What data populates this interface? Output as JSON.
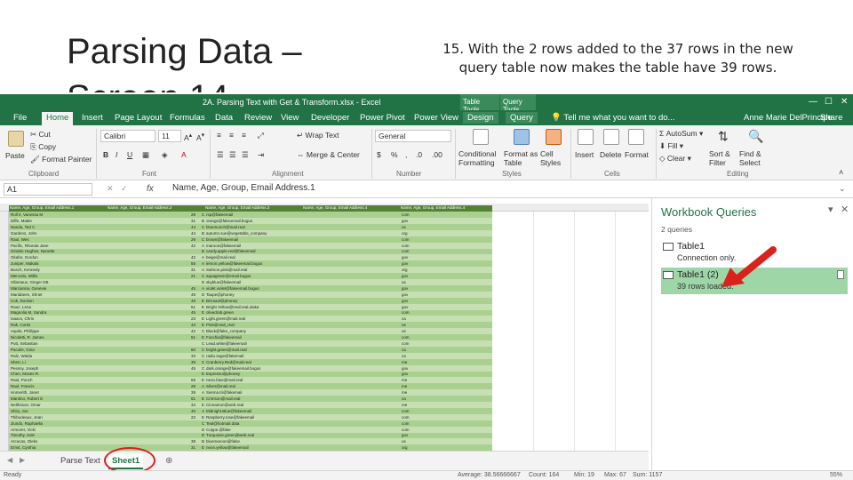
{
  "slide": {
    "title": "Parsing Data – Screen 14",
    "note": "15. With the 2 rows added to the 37 rows in the new query table now makes the table have 39 rows."
  },
  "excel": {
    "window_title": "2A. Parsing Text with Get & Transform.xlsx - Excel",
    "context_tabs": [
      "Table Tools",
      "Query Tools"
    ],
    "ribbon_tabs": [
      "File",
      "Home",
      "Insert",
      "Page Layout",
      "Formulas",
      "Data",
      "Review",
      "View",
      "Developer",
      "Power Pivot",
      "Power View",
      "Design",
      "Query"
    ],
    "active_tab": "Home",
    "tell_me": "Tell me what you want to do...",
    "user": "Anne Marie DelPrincipe",
    "share": "Share",
    "clipboard": {
      "paste": "Paste",
      "cut": "Cut",
      "copy": "Copy",
      "format_painter": "Format Painter",
      "label": "Clipboard"
    },
    "font": {
      "name": "Calibri",
      "size": "11",
      "label": "Font"
    },
    "alignment": {
      "wrap": "Wrap Text",
      "merge": "Merge & Center",
      "label": "Alignment"
    },
    "number": {
      "format": "General",
      "label": "Number"
    },
    "styles": {
      "conditional": "Conditional Formatting",
      "format_table": "Format as Table",
      "cell_styles": "Cell Styles",
      "label": "Styles"
    },
    "cells": {
      "insert": "Insert",
      "delete": "Delete",
      "format": "Format",
      "label": "Cells"
    },
    "editing": {
      "autosum": "AutoSum",
      "fill": "Fill",
      "clear": "Clear",
      "sort": "Sort & Filter",
      "find": "Find & Select",
      "label": "Editing"
    },
    "name_box": "A1",
    "formula": "Name, Age, Group, Email Address.1",
    "table_headers": [
      "Name, Age, Group, Email Address.1",
      "Name, Age, Group, Email Address.2",
      "Name, Age, Group, Email Address.3",
      "Name, Age, Group, Email Address.4"
    ],
    "rows": [
      [
        "Roll II, Vanessa M",
        "29",
        "C",
        "rsp@fakeemail",
        "com"
      ],
      [
        "Diffe, Mattie",
        "31",
        "B",
        "orange@falscemail.bogus",
        "gov"
      ],
      [
        "Nanda, Ted C",
        "44",
        "C",
        "bluemunch@mail.real",
        "us"
      ],
      [
        "Gardens, John",
        "44",
        "B",
        "autumn.sun@vegetable_company",
        "org"
      ],
      [
        "Raul, Wes",
        "29",
        "C",
        "brown@fakeemail",
        "com"
      ],
      [
        "Pacific, Rhonda Jane",
        "42",
        "A",
        "maroon@fakeemail",
        "com"
      ],
      [
        "Giraldo Hughes, Nanette",
        "",
        "B",
        "candy.apple.red@fakeemail",
        "com"
      ],
      [
        "Okafor, Gordon",
        "42",
        "A",
        "beige@mail.real",
        "gov"
      ],
      [
        "Juniper, Makala",
        "55",
        "A",
        "lemon.yellow@fakeemail.bogus",
        "gov"
      ],
      [
        "Bosch, Kennedy",
        "31",
        "A",
        "Salmon.pink@mail.real",
        "org"
      ],
      [
        "Mercutio, Willis",
        "21",
        "C",
        "aquagreen@email.bogus",
        "gov"
      ],
      [
        "Ollantaus, Ginger DB",
        "",
        "D",
        "skyblue@fakeemail",
        "us"
      ],
      [
        "Marcianna, Genevie",
        "45",
        "A",
        "violet.violet@fakeemail.bogus",
        "gov"
      ],
      [
        "Mariabeen, Shriet",
        "49",
        "D",
        "Taupe@phoney",
        "gov"
      ],
      [
        "Cok, Docken",
        "49",
        "E",
        "Bricsaol@phoney",
        "gov"
      ],
      [
        "Rauz, Lena",
        "61",
        "E",
        "Bright.Yellow@mail.real.ulaka",
        "gov"
      ],
      [
        "Magnolia M, Sandra",
        "45",
        "E",
        "olivedrab.green",
        "com"
      ],
      [
        "Isaacs, Chris",
        "23",
        "E",
        "Light.green@mail.real",
        "ca"
      ],
      [
        "Rak, Cortis",
        "43",
        "E",
        "Pink@mail_real",
        "us"
      ],
      [
        "Aquila, Phillippe",
        "42",
        "C",
        "Black@fake_company",
        "us"
      ],
      [
        "Nicoletti, R. James",
        "51",
        "E",
        "Fuschia@fakeemail",
        "com"
      ],
      [
        "Putt, Sebastian",
        "",
        "C",
        "Lead.white@fakeemail",
        "com"
      ],
      [
        "Pacoile, Gina",
        "60",
        "C",
        "bright.green@mail.real",
        "ca"
      ],
      [
        "Ralz, Walda",
        "33",
        "C",
        "radio.sage@fakemail",
        "ca"
      ],
      [
        "Sherr, Li",
        "39",
        "C",
        "Cranberry.Red@mail.real",
        "me"
      ],
      [
        "Pessny, Joseph",
        "45",
        "C",
        "dark.orange@fakeemail.bogus",
        "gov"
      ],
      [
        "Chen, Moses R.",
        "",
        "E",
        "Espresso@phoney",
        "gov"
      ],
      [
        "Raul, Ponch",
        "55",
        "E",
        "neon.blue@mail.real",
        "me"
      ],
      [
        "Raul, Francis",
        "29",
        "A",
        "Silver@mail.real",
        "me"
      ],
      [
        "Homerith, Janet",
        "39",
        "A",
        "Sienna.tri@fakemail",
        "me"
      ],
      [
        "Mantino, Robert E",
        "51",
        "E",
        "Crimson@mail.real",
        "ca"
      ],
      [
        "Nelthsson, Omar",
        "34",
        "E",
        "Cinnamon@web.real",
        "me"
      ],
      [
        "Shiry, Joe",
        "40",
        "A",
        "Midnight.Blue@fakeemail",
        "com"
      ],
      [
        "Thibodeaux, Jean",
        "22",
        "E",
        "Raspberry.rose@fakeemail",
        "com"
      ],
      [
        "Jiundo, Raphaella",
        "",
        "C",
        "Teal@hotmail.data",
        "com"
      ],
      [
        "Armorer, Vicki",
        "",
        "D",
        "Coppe.@fake",
        "com"
      ],
      [
        "Timothy, Sole",
        "",
        "D",
        "Turquoise.green@web.real",
        "gov"
      ],
      [
        "Arcucas, Oleks",
        "39",
        "B",
        "bluemaroon@false",
        "us"
      ],
      [
        "Ernst, Cynthia",
        "31",
        "E",
        "neon.yellow@fakeemail",
        "org"
      ]
    ],
    "sheet_tabs": [
      "Parse Text",
      "Sheet1"
    ],
    "active_sheet": "Sheet1",
    "status": {
      "ready": "Ready",
      "average": "Average: 38.56666667",
      "count": "Count: 164",
      "min": "Min: 19",
      "max": "Max: 67",
      "sum": "Sum: 1157",
      "zoom": "55%"
    },
    "pane": {
      "title": "Workbook Queries",
      "count": "2 queries",
      "queries": [
        {
          "name": "Table1",
          "status": "Connection only."
        },
        {
          "name": "Table1 (2)",
          "status": "39 rows loaded."
        }
      ]
    }
  },
  "colors": {
    "excel_green": "#217346",
    "table_header": "#548235",
    "table_band": "#c6e0b4",
    "selected_query": "#9fd6a8",
    "annotation_red": "#d9221c"
  }
}
